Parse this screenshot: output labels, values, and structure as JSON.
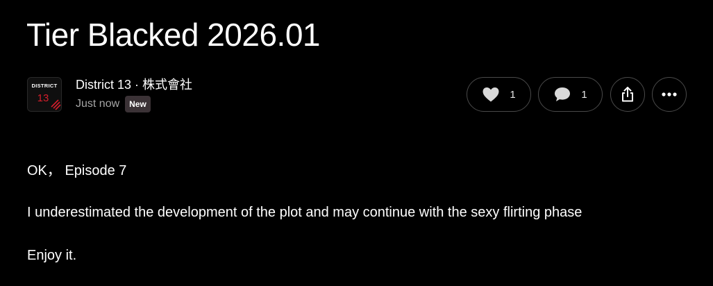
{
  "post": {
    "title": "Tier Blacked 2026.01",
    "author": "District 13 · 株式會社",
    "timestamp": "Just now",
    "badge": "New",
    "avatar_text_top": "DISTRICT",
    "avatar_text_num": "13",
    "paragraphs": [
      "OK， Episode 7",
      "I underestimated the development of the plot and may continue with the sexy flirting phase",
      "Enjoy it."
    ]
  },
  "actions": {
    "like_count": "1",
    "comment_count": "1",
    "like_icon": "heart-icon",
    "comment_icon": "comment-bubble-icon",
    "share_icon": "share-icon",
    "more_icon": "more-horizontal-icon"
  },
  "colors": {
    "background": "#000000",
    "text": "#ffffff",
    "muted": "#a6a6a6",
    "badge_bg": "#3b3236",
    "border": "#4a4a4a",
    "avatar_accent": "#d61f2c"
  }
}
